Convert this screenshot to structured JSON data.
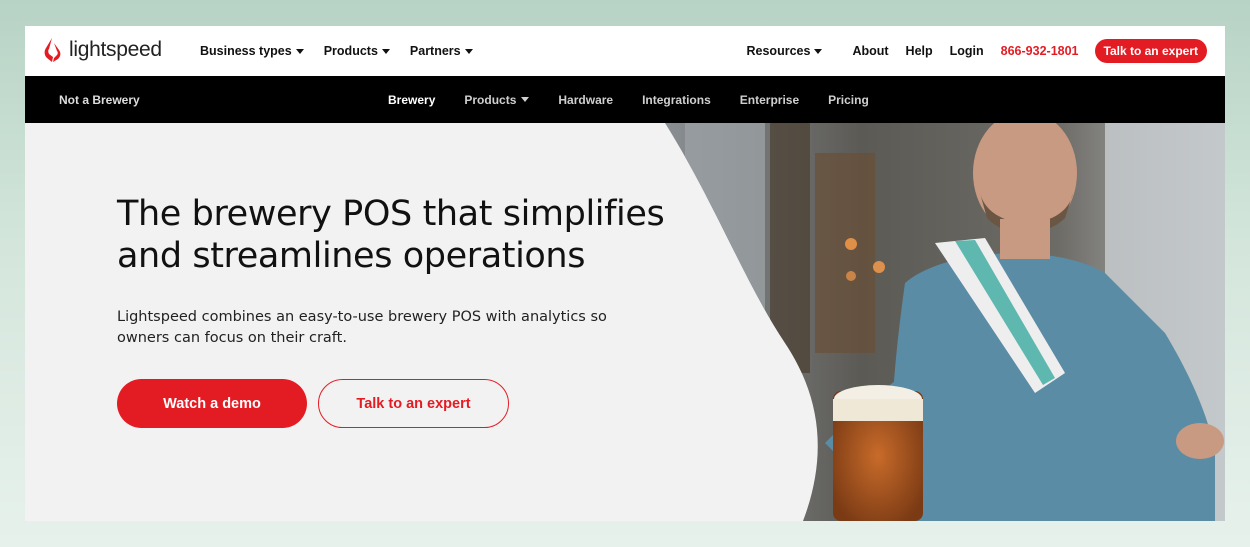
{
  "brand": {
    "name": "lightspeed",
    "color": "#e31c23"
  },
  "topnav": {
    "left": [
      {
        "label": "Business types",
        "has_caret": true
      },
      {
        "label": "Products",
        "has_caret": true
      },
      {
        "label": "Partners",
        "has_caret": true
      }
    ],
    "resources": "Resources",
    "about": "About",
    "help": "Help",
    "login": "Login",
    "phone": "866-932-1801",
    "cta": "Talk to an expert"
  },
  "subnav": {
    "context": "Not a Brewery",
    "items": [
      "Brewery",
      "Products",
      "Hardware",
      "Integrations",
      "Enterprise",
      "Pricing"
    ],
    "active": "Brewery"
  },
  "hero": {
    "headline_line1": "The brewery POS that simplifies",
    "headline_line2": "and streamlines operations",
    "subtext_line1": "Lightspeed combines an easy-to-use brewery POS with analytics so",
    "subtext_line2": "owners can focus on their craft.",
    "primary_button": "Watch a demo",
    "secondary_button": "Talk to an expert"
  },
  "icons": [
    "lightspeed-flame-icon",
    "chevron-down-icon"
  ]
}
